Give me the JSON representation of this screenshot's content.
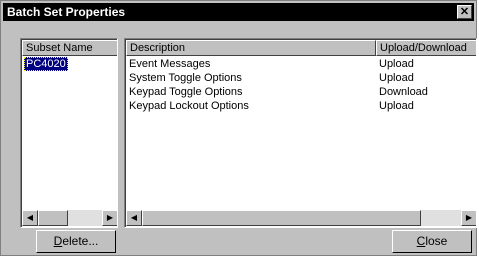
{
  "window": {
    "title": "Batch Set Properties",
    "close_glyph": "✕"
  },
  "subset_list": {
    "header": "Subset Name",
    "items": [
      "PC4020"
    ]
  },
  "table": {
    "columns": [
      "Description",
      "Upload/Download"
    ],
    "rows": [
      [
        "Event Messages",
        "Upload"
      ],
      [
        "System Toggle Options",
        "Upload"
      ],
      [
        "Keypad Toggle Options",
        "Download"
      ],
      [
        "Keypad Lockout Options",
        "Upload"
      ]
    ]
  },
  "buttons": {
    "delete_mnemonic": "D",
    "delete_rest": "elete...",
    "close_mnemonic": "C",
    "close_rest": "lose"
  },
  "scroll_arrows": {
    "left": "◀",
    "right": "▶"
  }
}
